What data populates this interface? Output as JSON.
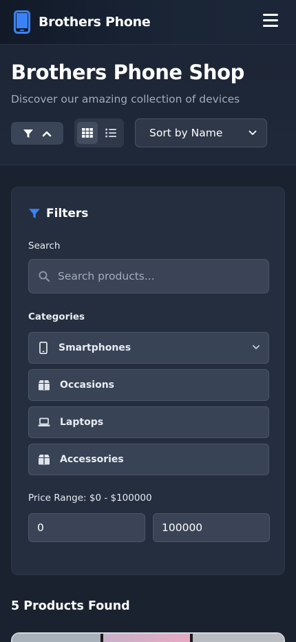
{
  "header": {
    "brand": "Brothers Phone",
    "icons": {
      "logo": "phone-icon",
      "menu": "hamburger-icon"
    }
  },
  "hero": {
    "title": "Brothers Phone Shop",
    "subtitle": "Discover our amazing collection of devices",
    "sort": {
      "selected": "Sort by Name"
    }
  },
  "filters": {
    "title": "Filters",
    "search_label": "Search",
    "search_placeholder": "Search products...",
    "categories_label": "Categories",
    "categories": [
      {
        "label": "Smartphones",
        "icon": "smartphone-icon"
      },
      {
        "label": "Occasions",
        "icon": "box-icon"
      },
      {
        "label": "Laptops",
        "icon": "laptop-icon"
      },
      {
        "label": "Accessories",
        "icon": "box-icon"
      }
    ],
    "price_label": "Price Range: $0 - $100000",
    "price_min": "0",
    "price_max": "100000"
  },
  "results": {
    "count_text": "5 Products Found"
  },
  "colors": {
    "accent": "#3b82f6",
    "background": "#1a2230",
    "panel": "#242e3f"
  }
}
